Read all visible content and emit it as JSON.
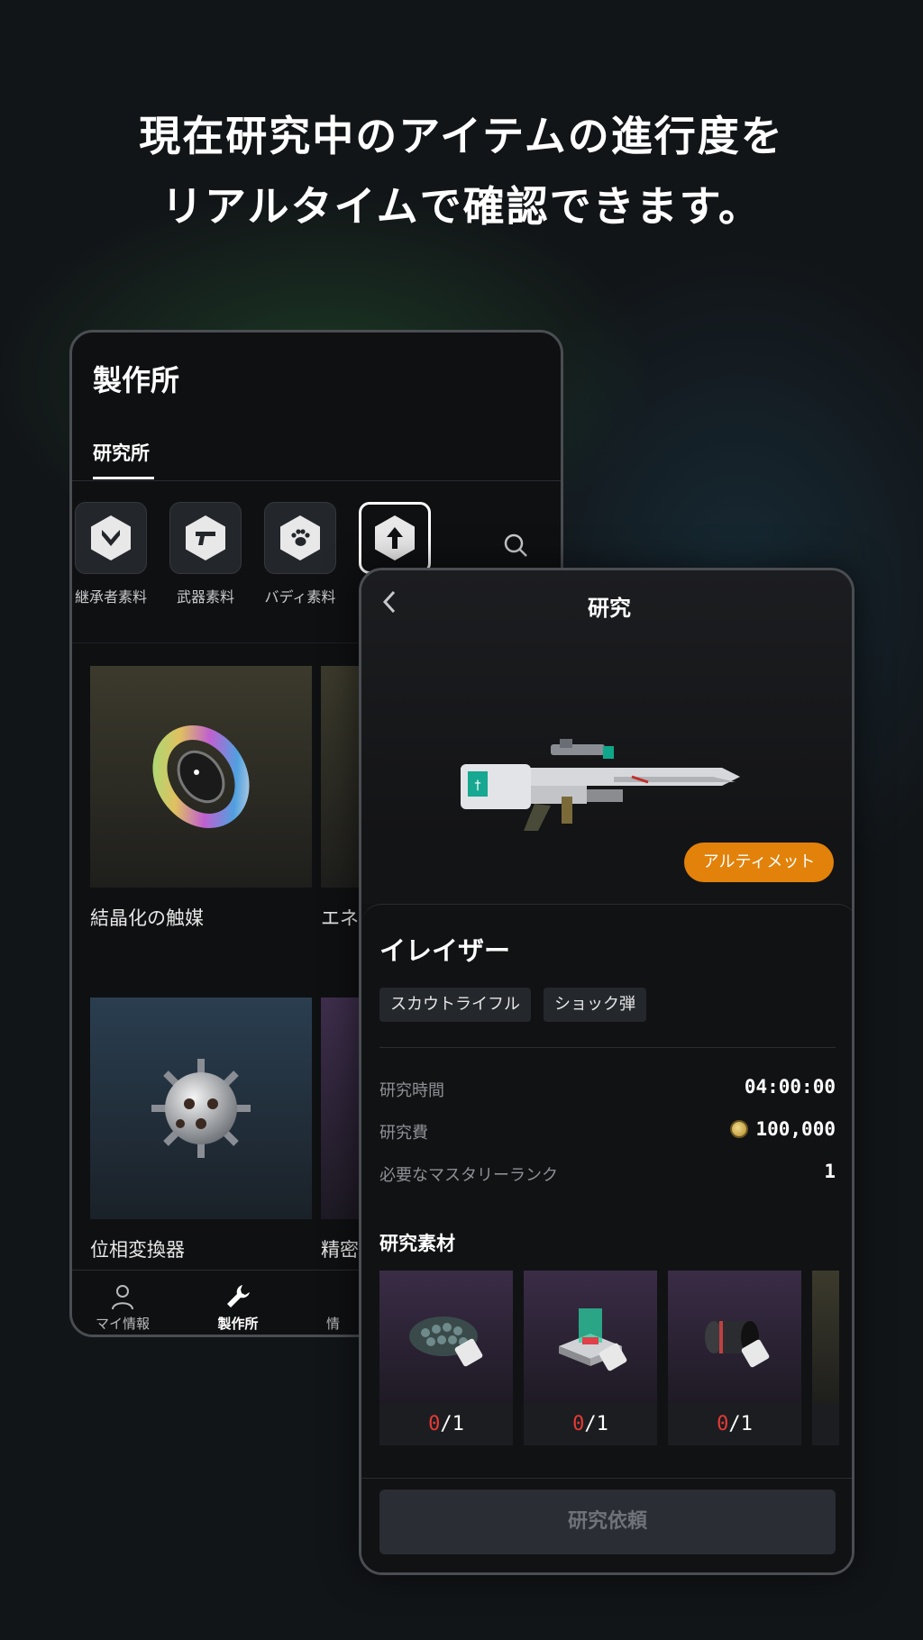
{
  "headline": {
    "line1": "現在研究中のアイテムの進行度を",
    "line2": "リアルタイムで確認できます。"
  },
  "workshop": {
    "title": "製作所",
    "tab": "研究所",
    "categories": [
      {
        "label": "継承者素料",
        "icon": "descendant-icon"
      },
      {
        "label": "武器素料",
        "icon": "pistol-icon"
      },
      {
        "label": "バディ素料",
        "icon": "paw-icon"
      },
      {
        "label": "",
        "icon": "upgrade-arrow-icon"
      }
    ],
    "items": [
      {
        "label": "結晶化の触媒"
      },
      {
        "label": "エネ"
      },
      {
        "label": "位相変換器"
      },
      {
        "label": "精密"
      }
    ],
    "nav": {
      "my_info": "マイ情報",
      "workshop": "製作所",
      "info": "情"
    }
  },
  "research": {
    "title": "研究",
    "grade_badge": "アルティメット",
    "item_name": "イレイザー",
    "tags": [
      "スカウトライフル",
      "ショック弾"
    ],
    "stats": {
      "time_label": "研究時間",
      "time_value": "04:00:00",
      "cost_label": "研究費",
      "cost_value": "100,000",
      "mastery_label": "必要なマスタリーランク",
      "mastery_value": "1"
    },
    "materials_title": "研究素材",
    "materials": [
      {
        "have": "0",
        "need": "/1"
      },
      {
        "have": "0",
        "need": "/1"
      },
      {
        "have": "0",
        "need": "/1"
      }
    ],
    "request_button": "研究依頼"
  },
  "colors": {
    "background": "#121518",
    "grade_orange": "#e2820a",
    "missing_red": "#e53a36"
  }
}
